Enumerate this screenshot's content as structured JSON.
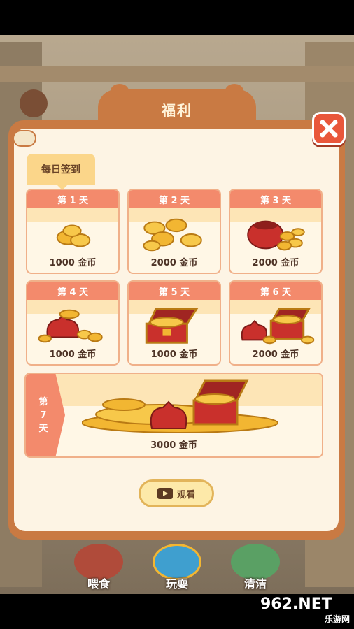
{
  "modal": {
    "title": "福利",
    "tab_label": "每日签到",
    "watch_button_label": "观看"
  },
  "rewards": [
    {
      "day": "第 1 天",
      "amount": "1000 金币",
      "art": "coin-pile-small-icon"
    },
    {
      "day": "第 2 天",
      "amount": "2000 金币",
      "art": "coin-pile-medium-icon"
    },
    {
      "day": "第 3 天",
      "amount": "2000 金币",
      "art": "coin-pot-icon"
    },
    {
      "day": "第 4 天",
      "amount": "1000 金币",
      "art": "money-bag-icon"
    },
    {
      "day": "第 5 天",
      "amount": "1000 金币",
      "art": "treasure-chest-icon"
    },
    {
      "day": "第 6 天",
      "amount": "2000 金币",
      "art": "chest-and-bag-icon"
    }
  ],
  "grand_reward": {
    "day_chars": [
      "第",
      "7",
      "天"
    ],
    "amount": "3000 金币",
    "art": "treasure-hoard-icon"
  },
  "bottom_bar": [
    {
      "label": "喂食",
      "icon": "food-bowl-icon"
    },
    {
      "label": "玩耍",
      "icon": "paw-toy-icon"
    },
    {
      "label": "清洁",
      "icon": "brush-icon"
    }
  ],
  "watermark": {
    "text": "962.NET",
    "sub": "乐游网"
  },
  "colors": {
    "panel": "#c97a43",
    "panel_inner": "#fdf4e4",
    "card_header": "#f38a6c",
    "close_button": "#e9573b",
    "gold": "#f2b632"
  }
}
